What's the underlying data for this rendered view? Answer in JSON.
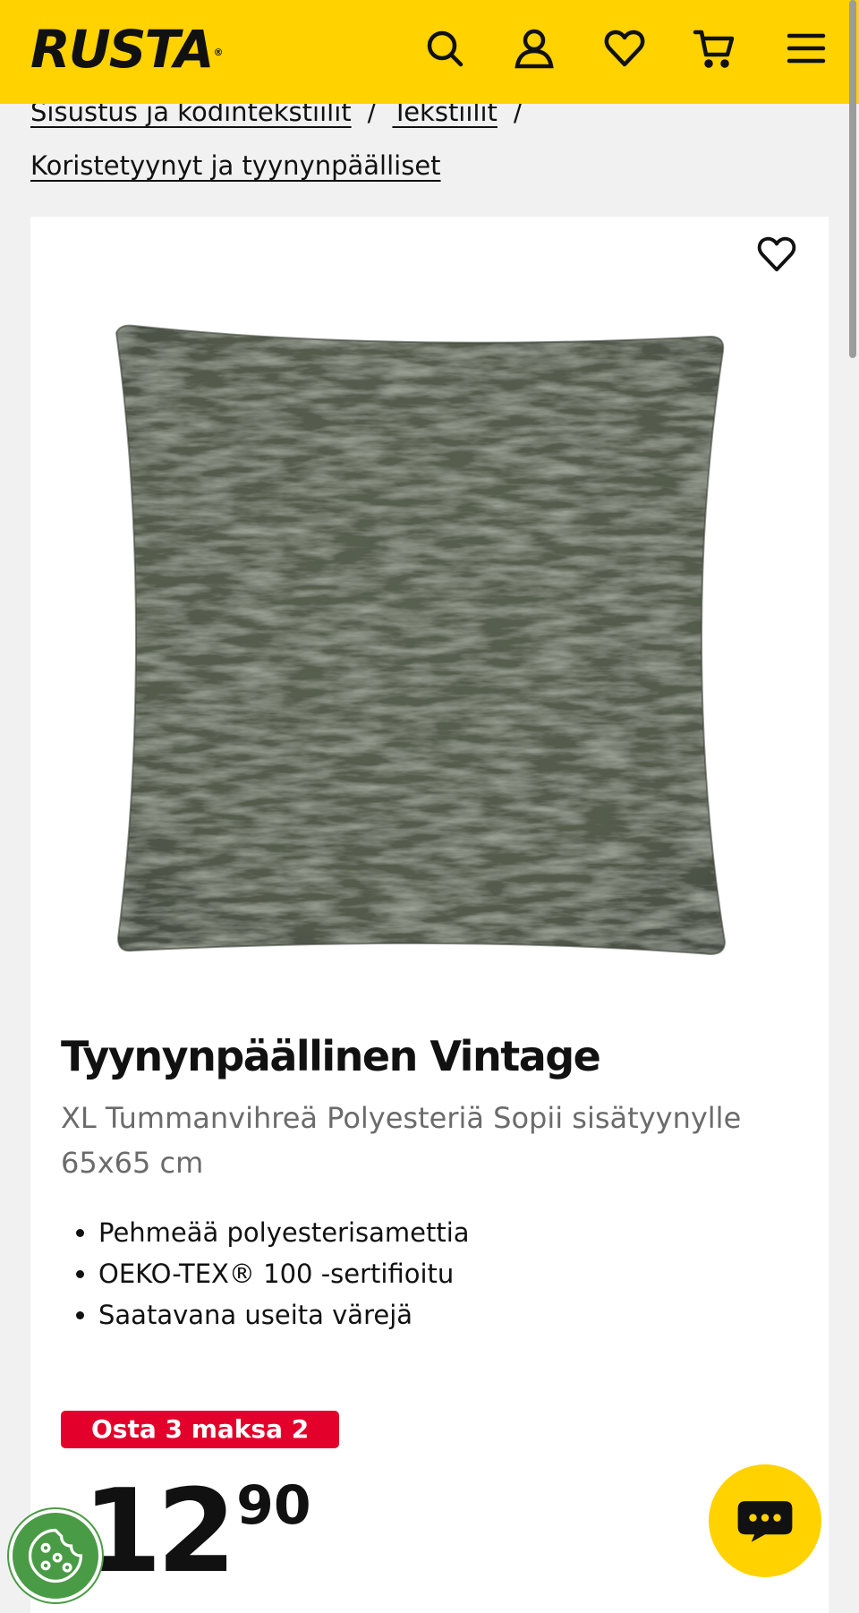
{
  "header": {
    "logo": "RUSTA",
    "logo_mark": "®",
    "icons": [
      "search-icon",
      "account-icon",
      "wishlist-icon",
      "cart-icon",
      "menu-icon"
    ],
    "background": "#ffd200"
  },
  "breadcrumb": {
    "items": [
      "Sisustus ja kodintekstiilit",
      "Tekstiilit",
      "Koristetyynyt ja tyynynpäälliset"
    ],
    "separator": "/"
  },
  "product": {
    "title": "Tyynynpäällinen Vintage",
    "subtitle": "XL Tummanvihreä Polyesteriä Sopii sisätyynylle 65x65 cm",
    "bullets": [
      "Pehmeää polyesterisamettia",
      "OEKO-TEX® 100 -sertifioitu",
      "Saatavana useita värejä"
    ],
    "promo": "Osta 3 maksa 2",
    "price_integer": "12",
    "price_decimals": "90",
    "image_color": "#5a6152"
  },
  "colors": {
    "accent": "#ffd200",
    "promo": "#e3002b",
    "cookie": "#4a9b45"
  }
}
